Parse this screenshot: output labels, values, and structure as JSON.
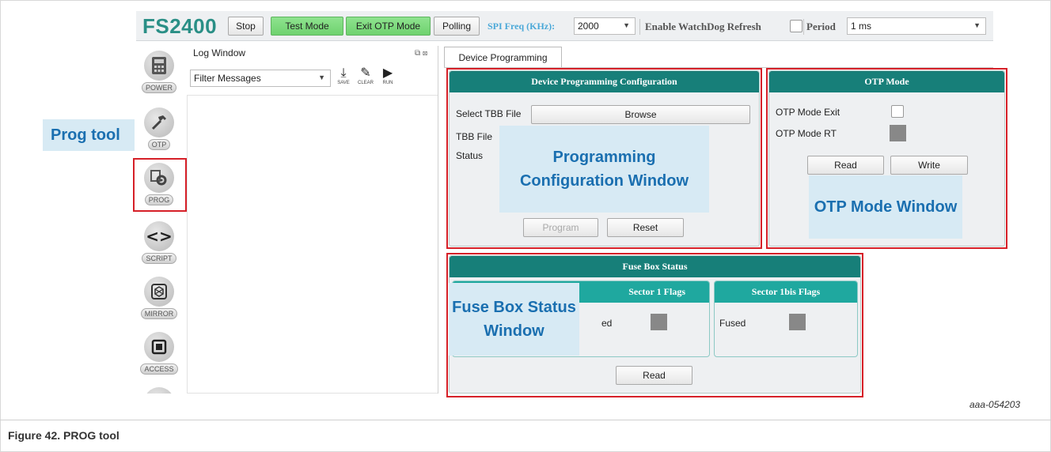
{
  "toolbar": {
    "brand": "FS2400",
    "stop": "Stop",
    "test_mode": "Test Mode",
    "exit_otp": "Exit OTP Mode",
    "polling": "Polling",
    "spi_label": "SPI Freq (KHz):",
    "spi_value": "2000",
    "watchdog_label": "Enable WatchDog Refresh",
    "period_label": "Period",
    "period_value": "1 ms"
  },
  "sidebar": {
    "items": [
      {
        "label": "POWER",
        "icon": "calculator-icon"
      },
      {
        "label": "OTP",
        "icon": "hammer-icon"
      },
      {
        "label": "PROG",
        "icon": "settings-gear-icon"
      },
      {
        "label": "SCRIPT",
        "icon": "code-icon"
      },
      {
        "label": "MIRROR",
        "icon": "mirror-icon"
      },
      {
        "label": "ACCESS",
        "icon": "chip-icon"
      }
    ]
  },
  "callout": "Prog tool",
  "log": {
    "title": "Log Window",
    "filter": "Filter Messages",
    "save": "SAVE",
    "clear": "CLEAR",
    "run": "RUN"
  },
  "tab": "Device Programming",
  "config": {
    "title": "Device Programming Configuration",
    "select_label": "Select TBB File",
    "browse": "Browse",
    "tbb_file": "TBB File",
    "status": "Status",
    "program": "Program",
    "reset": "Reset",
    "overlay": "Programming Configuration Window"
  },
  "otp": {
    "title": "OTP Mode",
    "exit_label": "OTP Mode Exit",
    "rt_label": "OTP Mode RT",
    "read": "Read",
    "write": "Write",
    "overlay": "OTP Mode Window"
  },
  "fuse": {
    "title": "Fuse Box Status",
    "sector1": "Sector 1 Flags",
    "sector1bis": "Sector 1bis Flags",
    "fused_partial": "ed",
    "fused": "Fused",
    "read": "Read",
    "overlay": "Fuse Box Status Window"
  },
  "figure": {
    "id": "aaa-054203",
    "caption": "Figure 42.  PROG tool"
  },
  "colors": {
    "teal_header": "#177f79",
    "highlight_red": "#d62028",
    "overlay_blue": "#1a6fb0"
  }
}
